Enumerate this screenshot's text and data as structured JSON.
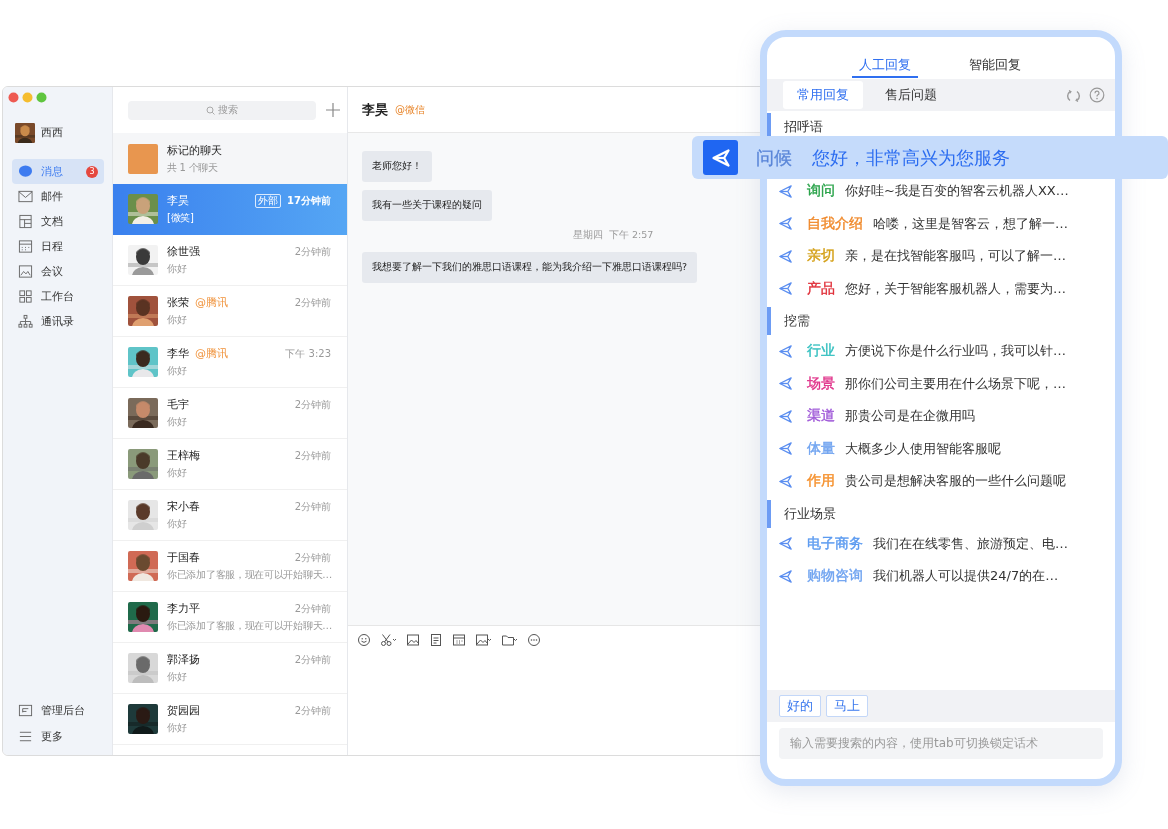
{
  "sidebar": {
    "user": {
      "name": "西西"
    },
    "nav": [
      {
        "kind": "chat",
        "label": "消息",
        "badge": "3",
        "selected": true
      },
      {
        "kind": "mail",
        "label": "邮件",
        "selected": false
      },
      {
        "kind": "docs",
        "label": "文档",
        "selected": false
      },
      {
        "kind": "calendar",
        "label": "日程",
        "selected": false
      },
      {
        "kind": "meeting",
        "label": "会议",
        "selected": false
      },
      {
        "kind": "apps",
        "label": "工作台",
        "selected": false
      },
      {
        "kind": "contacts",
        "label": "通讯录",
        "selected": false
      }
    ],
    "footer": [
      {
        "kind": "admin",
        "label": "管理后台"
      },
      {
        "kind": "more",
        "label": "更多"
      }
    ]
  },
  "chat_list": {
    "search": {
      "placeholder": "搜索"
    },
    "pinned": {
      "title": "标记的聊天",
      "subtitle": "共 1 个聊天"
    },
    "conversations": [
      {
        "name": "李昊",
        "tag": "外部",
        "time": "17分钟前",
        "preview": "[微笑]",
        "selected": true
      },
      {
        "name": "徐世强",
        "time": "2分钟前",
        "preview": "你好",
        "selected": false
      },
      {
        "name": "张荣",
        "source": "@腾讯",
        "time": "2分钟前",
        "preview": "你好",
        "selected": false
      },
      {
        "name": "李华",
        "source": "@腾讯",
        "time": "下午 3:23",
        "preview": "你好",
        "selected": false
      },
      {
        "name": "毛宇",
        "time": "2分钟前",
        "preview": "你好",
        "selected": false
      },
      {
        "name": "王梓梅",
        "time": "2分钟前",
        "preview": "你好",
        "selected": false
      },
      {
        "name": "宋小春",
        "time": "2分钟前",
        "preview": "你好",
        "selected": false
      },
      {
        "name": "于国春",
        "time": "2分钟前",
        "preview": "你已添加了客服，现在可以开始聊天…",
        "selected": false
      },
      {
        "name": "李力平",
        "time": "2分钟前",
        "preview": "你已添加了客服，现在可以开始聊天…",
        "selected": false
      },
      {
        "name": "郭泽扬",
        "time": "2分钟前",
        "preview": "你好",
        "selected": false
      },
      {
        "name": "贺园园",
        "time": "2分钟前",
        "preview": "你好",
        "selected": false
      }
    ]
  },
  "chat": {
    "title": "李昊",
    "source": "@微信",
    "messages": [
      {
        "kind": "message",
        "text": "老师您好！"
      },
      {
        "kind": "message",
        "text": "我有一些关于课程的疑问"
      },
      {
        "kind": "timestamp",
        "text": "星期四  下午 2:57"
      },
      {
        "kind": "message",
        "text": "我想要了解一下我们的雅思口语课程，能为我介绍一下雅思口语课程吗?"
      }
    ]
  },
  "reply_panel": {
    "tabs": [
      {
        "label": "人工回复",
        "selected": true
      },
      {
        "label": "智能回复",
        "selected": false
      }
    ],
    "subtabs": [
      {
        "label": "常用回复",
        "selected": true
      },
      {
        "label": "售后问题",
        "selected": false
      }
    ],
    "sections": [
      {
        "title": "招呼语",
        "items": [
          {
            "kind": "dragged",
            "tag": "问候",
            "color": "#5a86d8",
            "text": "您好，非常高兴为您服务"
          },
          {
            "kind": "reply",
            "tag": "询问",
            "color": "#2aa34a",
            "text": "你好哇~我是百变的智客云机器人XX…"
          },
          {
            "kind": "reply",
            "tag": "自我介绍",
            "color": "#f08a2c",
            "text": "哈喽，这里是智客云，想了解一…"
          },
          {
            "kind": "reply",
            "tag": "亲切",
            "color": "#d4a017",
            "text": "亲，是在找智能客服吗，可以了解一…"
          },
          {
            "kind": "reply",
            "tag": "产品",
            "color": "#e0303a",
            "text": "您好，关于智能客服机器人，需要为…"
          }
        ]
      },
      {
        "title": "挖需",
        "items": [
          {
            "kind": "reply",
            "tag": "行业",
            "color": "#36c0c0",
            "text": "方便说下你是什么行业吗，我可以针…"
          },
          {
            "kind": "reply",
            "tag": "场景",
            "color": "#e0338a",
            "text": "那你们公司主要用在什么场景下呢，…"
          },
          {
            "kind": "reply",
            "tag": "渠道",
            "color": "#a05ad8",
            "text": "那贵公司是在企微用吗"
          },
          {
            "kind": "reply",
            "tag": "体量",
            "color": "#6fa3f0",
            "text": "大概多少人使用智能客服呢"
          },
          {
            "kind": "reply",
            "tag": "作用",
            "color": "#f5902c",
            "text": "贵公司是想解决客服的一些什么问题呢"
          }
        ]
      },
      {
        "title": "行业场景",
        "items": [
          {
            "kind": "reply",
            "tag": "电子商务",
            "color": "#5b9af0",
            "text": "我们在在线零售、旅游预定、电…"
          },
          {
            "kind": "reply",
            "tag": "购物咨询",
            "color": "#6fa3f0",
            "text": "我们机器人可以提供24/7的在…"
          }
        ]
      }
    ],
    "quick_replies": [
      "好的",
      "马上"
    ],
    "search": {
      "placeholder": "输入需要搜索的内容，使用tab可切换锁定话术"
    }
  }
}
